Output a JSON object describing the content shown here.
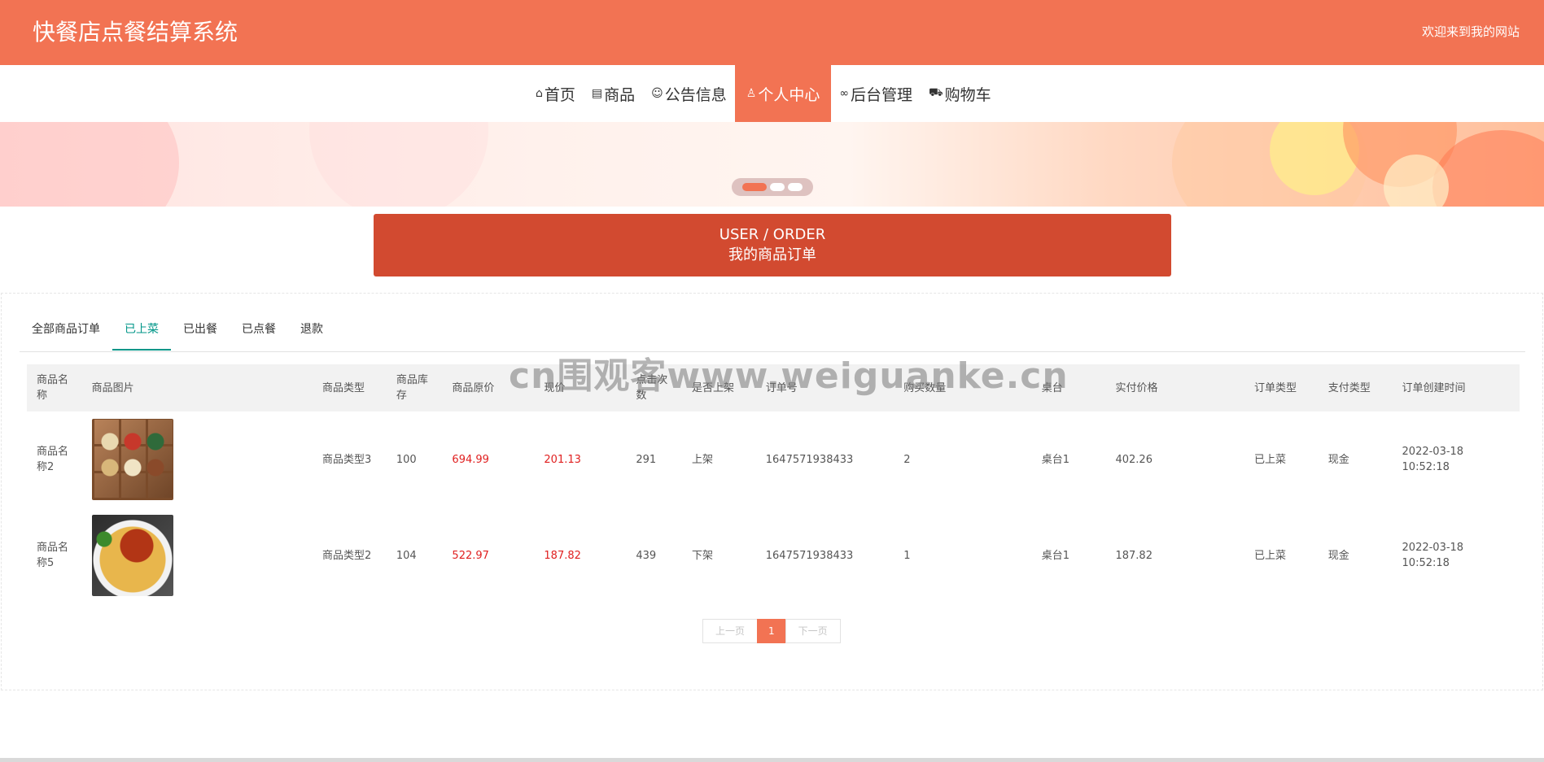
{
  "header": {
    "title": "快餐店点餐结算系统",
    "welcome": "欢迎来到我的网站",
    "bg_color": "#f27353"
  },
  "nav": {
    "items": [
      {
        "label": "首页",
        "icon": "home-icon"
      },
      {
        "label": "商品",
        "icon": "product-icon"
      },
      {
        "label": "公告信息",
        "icon": "palette-icon"
      },
      {
        "label": "个人中心",
        "icon": "user-icon",
        "active": true
      },
      {
        "label": "后台管理",
        "icon": "link-icon"
      },
      {
        "label": "购物车",
        "icon": "cart-icon"
      }
    ]
  },
  "banner": {
    "slides": 3,
    "active_slide": 1
  },
  "section": {
    "en": "USER / ORDER",
    "cn": "我的商品订单"
  },
  "tabs": [
    {
      "label": "全部商品订单",
      "active": false
    },
    {
      "label": "已上菜",
      "active": true
    },
    {
      "label": "已出餐",
      "active": false
    },
    {
      "label": "已点餐",
      "active": false
    },
    {
      "label": "退款",
      "active": false
    }
  ],
  "table": {
    "headers": [
      "商品名称",
      "商品图片",
      "商品类型",
      "商品库存",
      "商品原价",
      "现价",
      "点击次数",
      "是否上架",
      "订单号",
      "购买数量",
      "桌台",
      "实付价格",
      "订单类型",
      "支付类型",
      "订单创建时间"
    ],
    "rows": [
      {
        "name": "商品名称2",
        "image": "food-photo-snacks-tray",
        "type": "商品类型3",
        "stock": "100",
        "original_price": "694.99",
        "price": "201.13",
        "clicks": "291",
        "on_shelf": "上架",
        "order_no": "1647571938433",
        "quantity": "2",
        "table": "桌台1",
        "paid": "402.26",
        "order_type": "已上菜",
        "pay_type": "现金",
        "created": "2022-03-18 10:52:18"
      },
      {
        "name": "商品名称5",
        "image": "food-photo-spaghetti",
        "type": "商品类型2",
        "stock": "104",
        "original_price": "522.97",
        "price": "187.82",
        "clicks": "439",
        "on_shelf": "下架",
        "order_no": "1647571938433",
        "quantity": "1",
        "table": "桌台1",
        "paid": "187.82",
        "order_type": "已上菜",
        "pay_type": "现金",
        "created": "2022-03-18 10:52:18"
      }
    ]
  },
  "pager": {
    "prev": "上一页",
    "current": "1",
    "next": "下一页"
  },
  "watermark": "cn围观客www.weiguanke.cn"
}
